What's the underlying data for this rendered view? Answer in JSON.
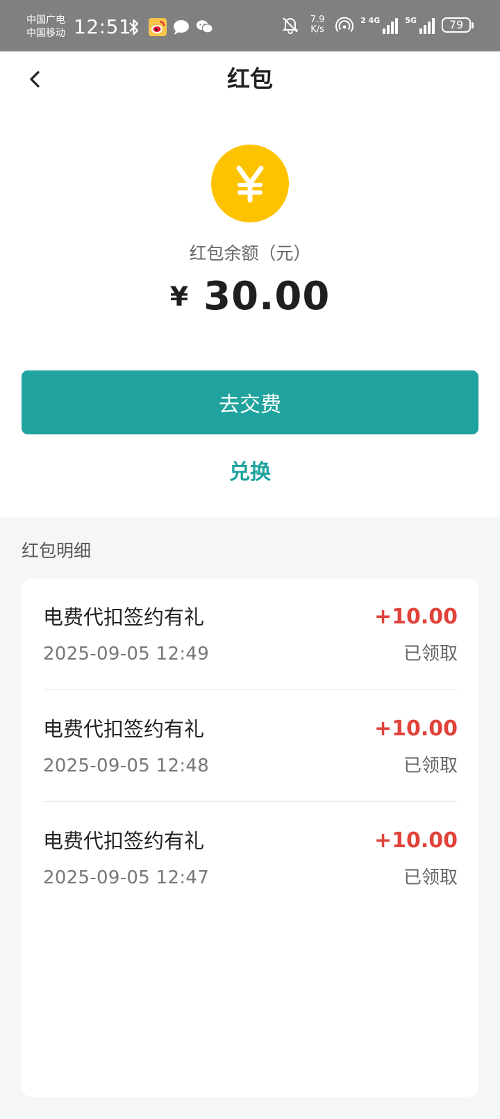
{
  "status_bar": {
    "carrier_1": "中国广电",
    "carrier_2": "中国移动",
    "time": "12:51",
    "net_speed_value": "7.9",
    "net_speed_unit": "K/s",
    "sim1_label": "4G",
    "sim1_sup": "2",
    "sim2_label": "5G",
    "battery": "79",
    "icons_left": [
      "bluetooth-icon",
      "weibo-icon",
      "message-icon",
      "wechat-icon"
    ],
    "icons_right": [
      "bell-off-icon",
      "hotspot-icon"
    ]
  },
  "header": {
    "title": "红包",
    "back_icon": "chevron-left-icon"
  },
  "balance": {
    "coin_symbol": "¥",
    "label": "红包余额（元）",
    "currency": "¥",
    "amount": "30.00",
    "coin_color": "#fdc300"
  },
  "actions": {
    "pay_label": "去交费",
    "exchange_label": "兑换",
    "accent_color": "#20a39e"
  },
  "details": {
    "section_title": "红包明细",
    "records": [
      {
        "name": "电费代扣签约有礼",
        "amount": "+10.00",
        "time": "2025-09-05 12:49",
        "status": "已领取"
      },
      {
        "name": "电费代扣签约有礼",
        "amount": "+10.00",
        "time": "2025-09-05 12:48",
        "status": "已领取"
      },
      {
        "name": "电费代扣签约有礼",
        "amount": "+10.00",
        "time": "2025-09-05 12:47",
        "status": "已领取"
      }
    ],
    "amount_color": "#e0433a"
  }
}
